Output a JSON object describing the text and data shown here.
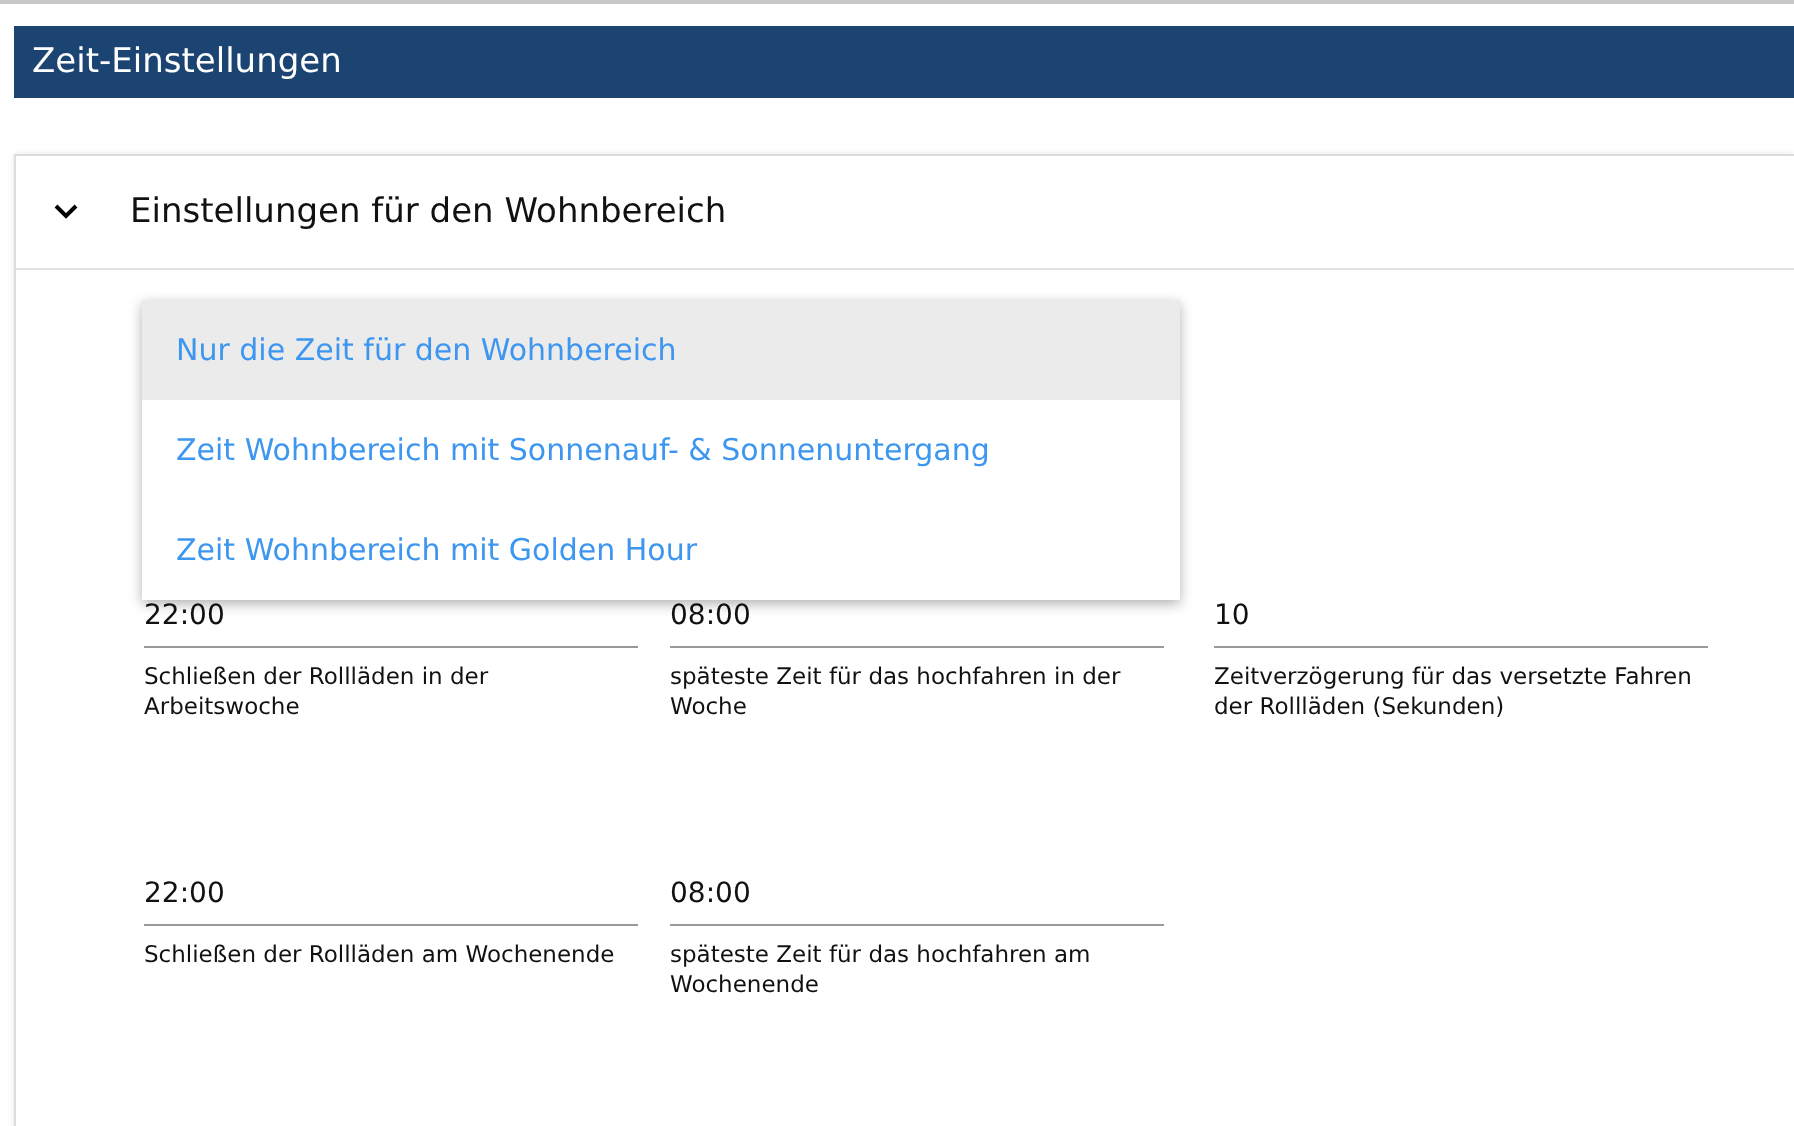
{
  "header": {
    "title": "Zeit-Einstellungen"
  },
  "panel": {
    "title": "Einstellungen für den Wohnbereich",
    "expanded": true,
    "dropdown": {
      "open": true,
      "options": [
        {
          "label": "Nur die Zeit für den Wohnbereich",
          "selected": true
        },
        {
          "label": "Zeit Wohnbereich mit Sonnenauf- & Sonnenuntergang",
          "selected": false
        },
        {
          "label": "Zeit Wohnbereich mit Golden Hour",
          "selected": false
        }
      ]
    },
    "field_rows": [
      [
        {
          "value": "22:00",
          "label": "Schließen der Rollläden in der Arbeitswoche"
        },
        {
          "value": "08:00",
          "label": "späteste Zeit für das hochfahren in der Woche"
        },
        {
          "value": "10",
          "label": "Zeitverzögerung für das versetzte Fahren der Rollläden (Sekunden)"
        }
      ],
      [
        {
          "value": "22:00",
          "label": "Schließen der Rollläden am Wochenende"
        },
        {
          "value": "08:00",
          "label": "späteste Zeit für das hochfahren am Wochenende"
        }
      ]
    ]
  }
}
